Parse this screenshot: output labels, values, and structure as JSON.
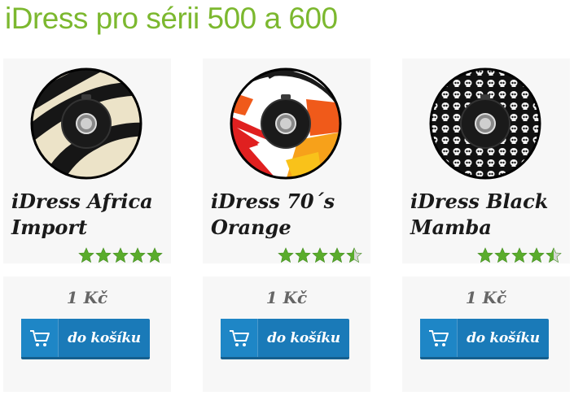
{
  "page": {
    "title": "iDress pro sérii 500 a 600"
  },
  "colors": {
    "title_green": "#7cb82f",
    "star_green": "#5aac2c",
    "button_blue": "#1a7ab8"
  },
  "products": [
    {
      "name_line1": "iDress Africa",
      "name_line2": "Import",
      "rating": 5,
      "rating_max": 5,
      "price": "1 Kč",
      "button_label": "do košíku",
      "design": "zebra"
    },
    {
      "name_line1": "iDress 70´s",
      "name_line2": "Orange",
      "rating": 4.5,
      "rating_max": 5,
      "price": "1 Kč",
      "button_label": "do košíku",
      "design": "orange-retro"
    },
    {
      "name_line1": "iDress Black",
      "name_line2": "Mamba",
      "rating": 4.5,
      "rating_max": 5,
      "price": "1 Kč",
      "button_label": "do košíku",
      "design": "skulls"
    }
  ],
  "icons": {
    "cart": "shopping-cart-icon",
    "star": "star-icon"
  }
}
